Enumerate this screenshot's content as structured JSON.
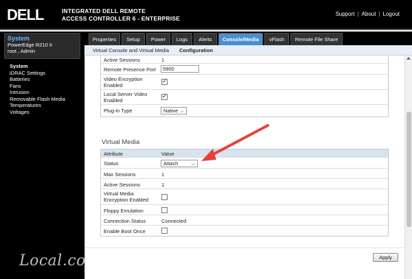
{
  "header": {
    "logo_text": "DELL",
    "product_line1": "INTEGRATED DELL REMOTE",
    "product_line2": "ACCESS CONTROLLER 6 - ENTERPRISE",
    "links": {
      "support": "Support",
      "about": "About",
      "logout": "Logout"
    }
  },
  "sidebar": {
    "system_title": "System",
    "model": "PowerEdge R210 II",
    "user": "root , Admin",
    "items": [
      {
        "label": "System",
        "active": true
      },
      {
        "label": "iDRAC Settings"
      },
      {
        "label": "Batteries"
      },
      {
        "label": "Fans"
      },
      {
        "label": "Intrusion"
      },
      {
        "label": "Removable Flash Media"
      },
      {
        "label": "Temperatures"
      },
      {
        "label": "Voltages"
      }
    ]
  },
  "tabs": {
    "properties": "Properties",
    "setup": "Setup",
    "power": "Power",
    "logs": "Logs",
    "alerts": "Alerts",
    "console_media": "Console/Media",
    "vflash": "vFlash",
    "remote_file_share": "Remote File Share"
  },
  "subnav": {
    "vcvm": "Virtual Console and Virtual Media",
    "configuration": "Configuration"
  },
  "console_table": {
    "active_sessions_label": "Active Sessions",
    "active_sessions_value": "1",
    "port_label": "Remote Presence Port",
    "port_value": "5900",
    "video_enc_label_1": "Video Encryption",
    "video_enc_label_2": "Enabled",
    "local_video_label_1": "Local Server Video",
    "local_video_label_2": "Enabled",
    "plugin_label": "Plug-in Type",
    "plugin_value": "Native"
  },
  "virtual_media": {
    "title": "Virtual Media",
    "col_attribute": "Attribute",
    "col_value": "Value",
    "status_label": "Status",
    "status_value": "Attach",
    "max_sessions_label": "Max Sessions",
    "max_sessions_value": "1",
    "active_sessions_label": "Active Sessions",
    "active_sessions_value": "1",
    "vm_enc_label_1": "Virtual Media",
    "vm_enc_label_2": "Encryption Enabled",
    "floppy_label": "Floppy Emulation",
    "conn_status_label": "Connection Status",
    "conn_status_value": "Connected",
    "boot_once_label": "Enable Boot Once"
  },
  "apply_label": "Apply",
  "watermark": "Local.com",
  "colors": {
    "accent_tab": "#4a8fd0",
    "annotation_arrow": "#e8403a",
    "header_bg": "#000000"
  }
}
